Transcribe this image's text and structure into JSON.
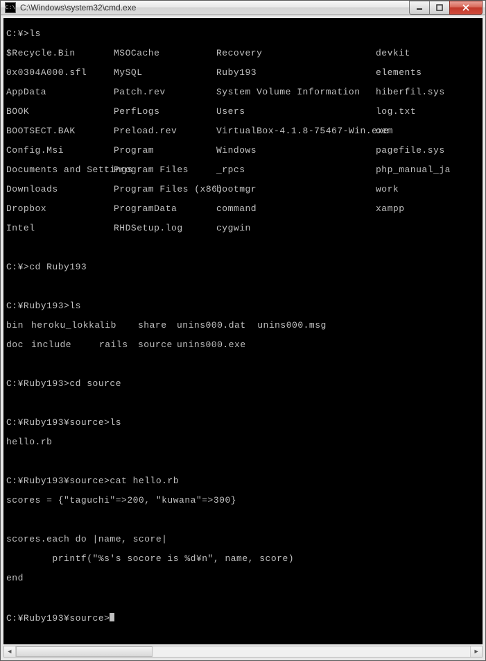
{
  "window": {
    "title": "C:\\Windows\\system32\\cmd.exe",
    "icon_text": "C:\\"
  },
  "term": {
    "p1": "C:¥>ls",
    "cols": [
      [
        "$Recycle.Bin",
        "MSOCache",
        "Recovery",
        "devkit"
      ],
      [
        "0x0304A000.sfl",
        "MySQL",
        "Ruby193",
        "elements"
      ],
      [
        "AppData",
        "Patch.rev",
        "System Volume Information",
        "hiberfil.sys"
      ],
      [
        "BOOK",
        "PerfLogs",
        "Users",
        "log.txt"
      ],
      [
        "BOOTSECT.BAK",
        "Preload.rev",
        "VirtualBox-4.1.8-75467-Win.exe",
        "oem"
      ],
      [
        "Config.Msi",
        "Program",
        "Windows",
        "pagefile.sys"
      ],
      [
        "Documents and Settings",
        "Program Files",
        "_rpcs",
        "php_manual_ja"
      ],
      [
        "Downloads",
        "Program Files (x86)",
        "bootmgr",
        "work"
      ],
      [
        "Dropbox",
        "ProgramData",
        "command",
        "xampp"
      ],
      [
        "Intel",
        "RHDSetup.log",
        "cygwin",
        ""
      ]
    ],
    "p2": "C:¥>cd Ruby193",
    "p3": "C:¥Ruby193>ls",
    "ruby_row1": [
      "bin",
      "heroku_lokka",
      "lib",
      "share",
      "unins000.dat  unins000.msg"
    ],
    "ruby_row2": [
      "doc",
      "include",
      "rails",
      "source",
      "unins000.exe"
    ],
    "p4": "C:¥Ruby193>cd source",
    "p5": "C:¥Ruby193¥source>ls",
    "p5r": "hello.rb",
    "p6": "C:¥Ruby193¥source>cat hello.rb",
    "code1": "scores = {\"taguchi\"=>200, \"kuwana\"=>300}",
    "code2": "scores.each do |name, score|",
    "code3": "        printf(\"%s's socore is %d¥n\", name, score)",
    "code4": "end",
    "p7": "C:¥Ruby193¥source>"
  }
}
